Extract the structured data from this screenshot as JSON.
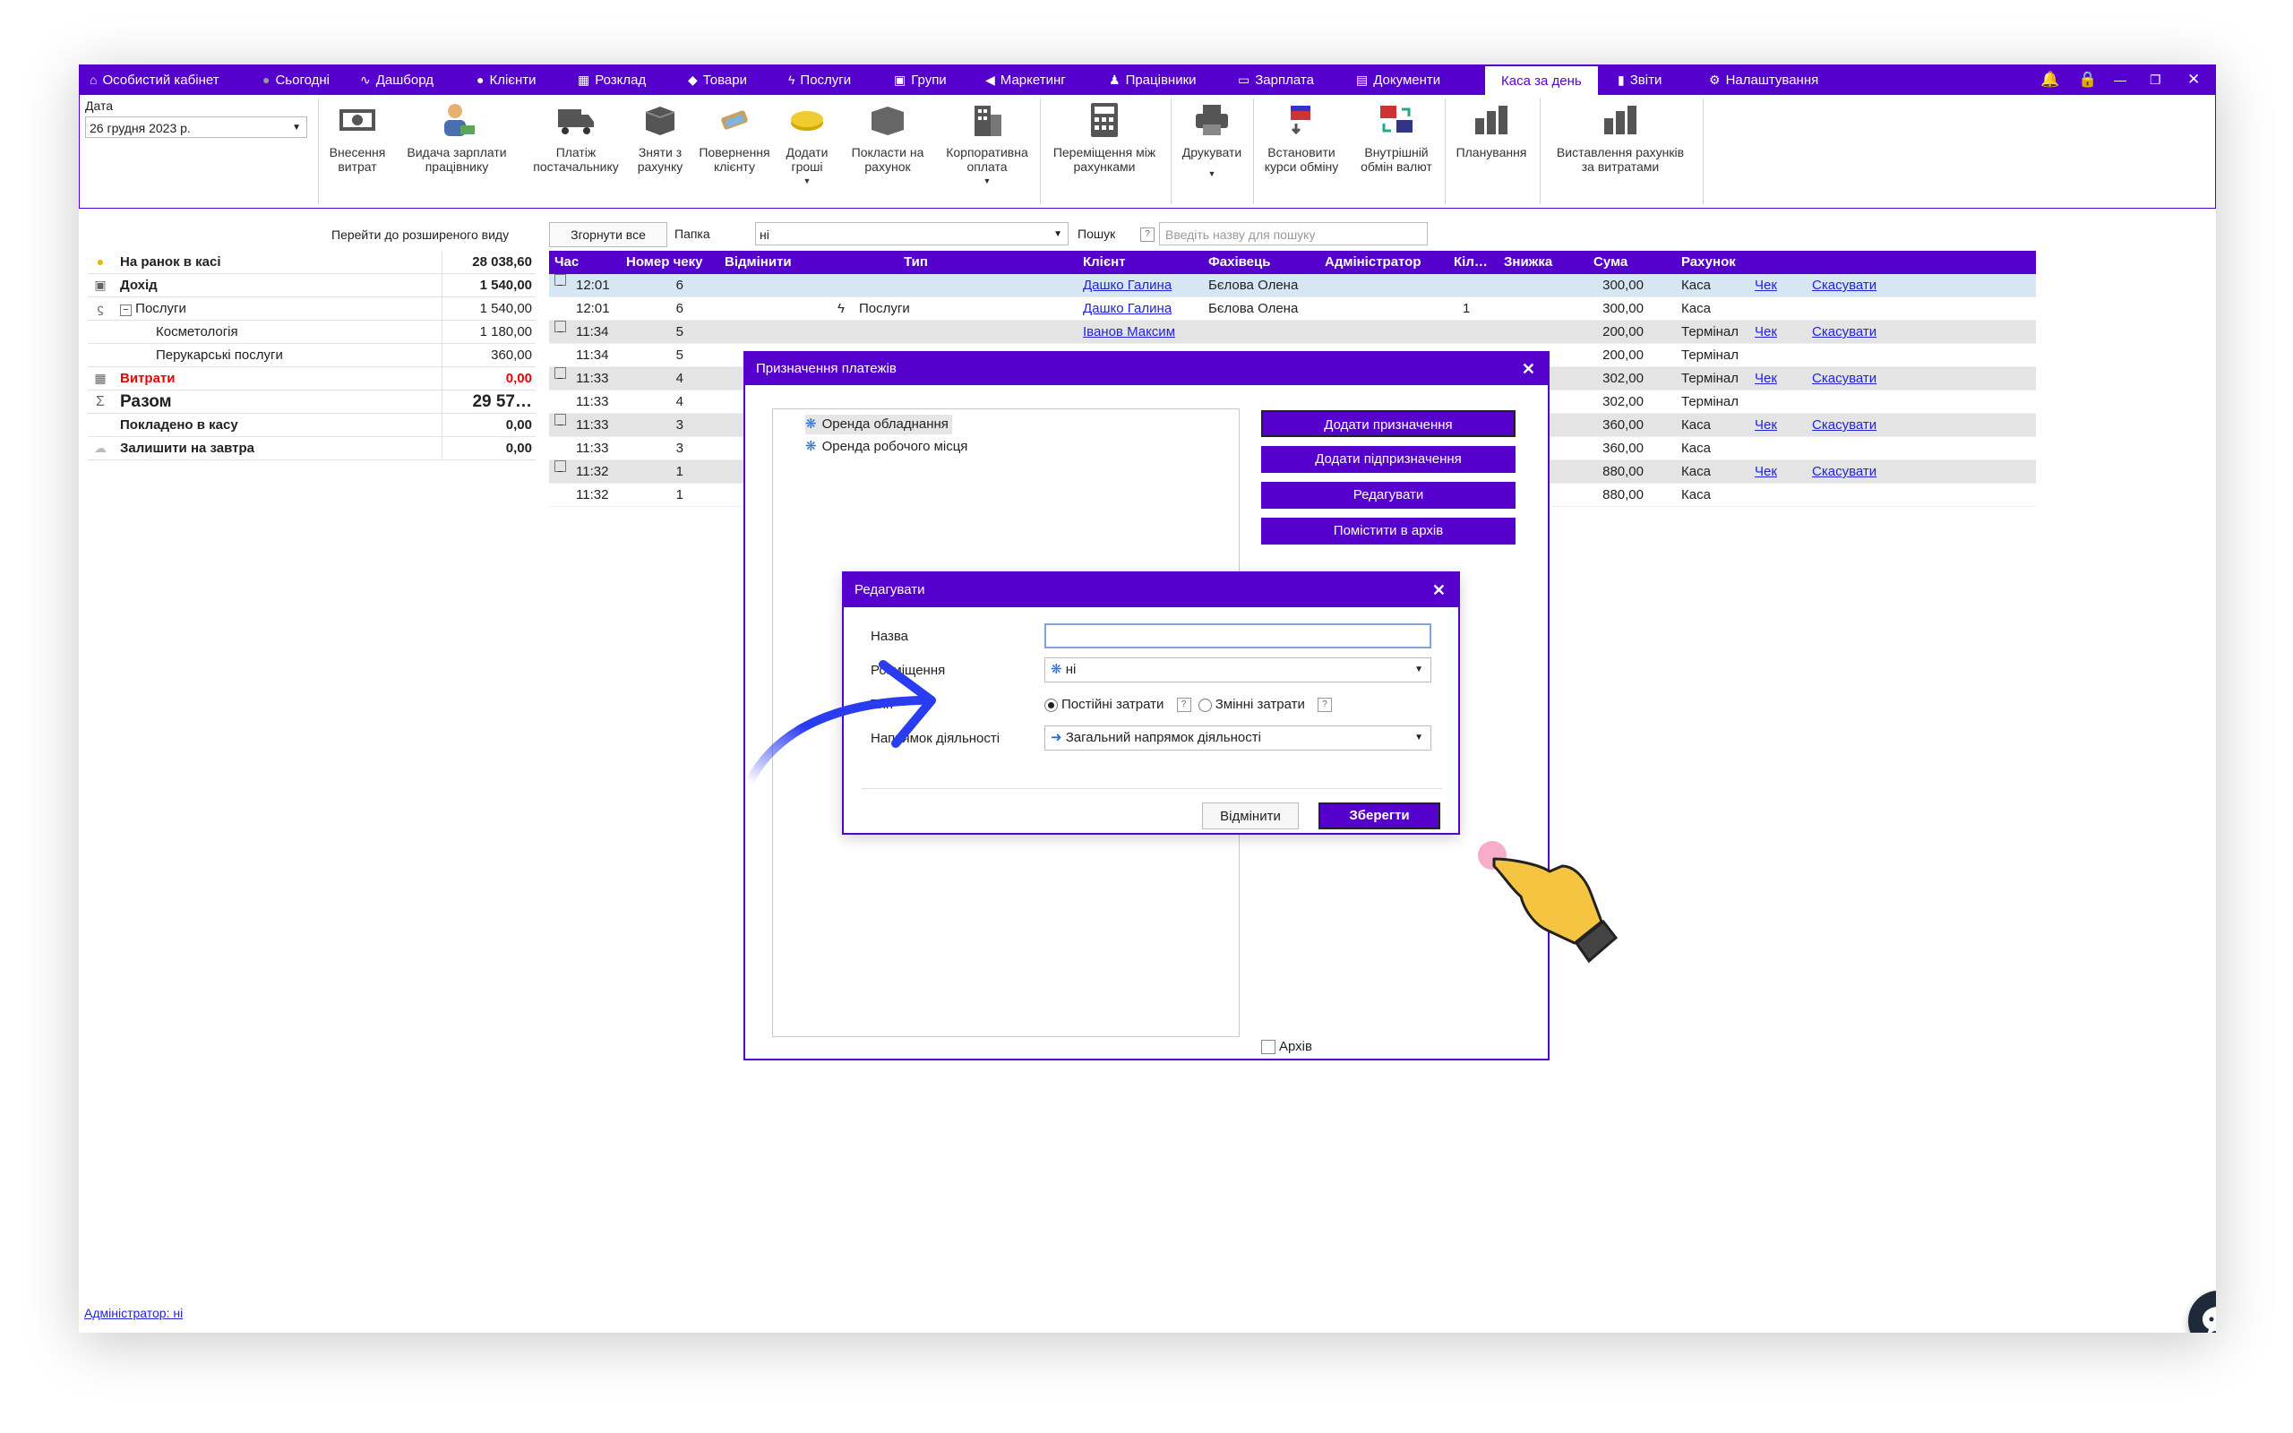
{
  "nav": {
    "items": [
      {
        "icon": "house-icon",
        "glyph": "⌂",
        "label": "Особистий кабінет"
      },
      {
        "icon": "clock-icon",
        "glyph": "●",
        "label": "Сьогодні"
      },
      {
        "icon": "pulse-icon",
        "glyph": "∿",
        "label": "Дашборд"
      },
      {
        "icon": "user-circle-icon",
        "glyph": "●",
        "label": "Клієнти"
      },
      {
        "icon": "calendar-icon",
        "glyph": "▦",
        "label": "Розклад"
      },
      {
        "icon": "box-icon",
        "glyph": "◆",
        "label": "Товари"
      },
      {
        "icon": "lightning-icon",
        "glyph": "ϟ",
        "label": "Послуги"
      },
      {
        "icon": "group-icon",
        "glyph": "▣",
        "label": "Групи"
      },
      {
        "icon": "megaphone-icon",
        "glyph": "◀",
        "label": "Маркетинг"
      },
      {
        "icon": "person-icon",
        "glyph": "♟",
        "label": "Працівники"
      },
      {
        "icon": "money-icon",
        "glyph": "▭",
        "label": "Зарплата"
      },
      {
        "icon": "document-icon",
        "glyph": "▤",
        "label": "Документи"
      },
      {
        "icon": "",
        "glyph": "",
        "label": "Каса за день"
      },
      {
        "icon": "bar-chart-icon",
        "glyph": "▮",
        "label": "Звіти"
      },
      {
        "icon": "gear-icon",
        "glyph": "⚙",
        "label": "Налаштування"
      }
    ]
  },
  "ribbon": {
    "date_label": "Дата",
    "date_value": "26 грудня  2023 р.",
    "buttons": [
      {
        "label": "Внесення\nвитрат",
        "glyph": "▣"
      },
      {
        "label": "Видача зарплати\nпрацівнику",
        "glyph": "♟"
      },
      {
        "label": "Платіж\nпостачальнику",
        "glyph": "▰"
      },
      {
        "label": "Зняти з\nрахунку",
        "glyph": "▩"
      },
      {
        "label": "Повернення\nклієнту",
        "glyph": "✎"
      },
      {
        "label": "Додати\nгроші",
        "glyph": "◉"
      },
      {
        "label": "Покласти на\nрахунок",
        "glyph": "▦"
      },
      {
        "label": "Корпоративна\nоплата",
        "glyph": "▥"
      },
      {
        "label": "Переміщення між\nрахунками",
        "glyph": "▦"
      },
      {
        "label": "Друкувати",
        "glyph": "▤"
      },
      {
        "label": "Встановити\nкурси обміну",
        "glyph": "⇅"
      },
      {
        "label": "Внутрішній\nобмін валют",
        "glyph": "⇄"
      },
      {
        "label": "Планування",
        "glyph": "▮"
      },
      {
        "label": "Виставлення рахунків\nза витратами",
        "glyph": "▮"
      }
    ]
  },
  "summary": {
    "ext_link": "Перейти до розширеного виду",
    "rows": [
      {
        "label": "На ранок в касі",
        "value": "28 038,60"
      },
      {
        "label": "Дохід",
        "value": "1 540,00"
      },
      {
        "label": "Послуги",
        "value": "1 540,00"
      },
      {
        "label": "Косметологія",
        "value": "1 180,00"
      },
      {
        "label": "Перукарські послуги",
        "value": "360,00"
      },
      {
        "label": "Витрати",
        "value": "0,00"
      },
      {
        "label": "Разом",
        "value": "29 57…"
      },
      {
        "label": "Покладено в касу",
        "value": "0,00"
      },
      {
        "label": "Залишити на завтра",
        "value": "0,00"
      }
    ]
  },
  "grid_toolbar": {
    "collapse_all": "Згорнути все",
    "folder_label": "Папка",
    "folder_value": "ні",
    "search_label": "Пошук",
    "search_placeholder": "Введіть назву для пошуку",
    "help": "?"
  },
  "grid": {
    "headers": [
      "Час",
      "Номер чеку",
      "Відмінити",
      "Тип",
      "Клієнт",
      "Фахівець",
      "Адміністратор",
      "Кіл…",
      "Знижка",
      "Сума",
      "Рахунок"
    ],
    "rows": [
      {
        "time": "12:01",
        "num": "6",
        "type": "",
        "client": "Дашко Галина",
        "master": "Бєлова Олена",
        "qty": "",
        "sum": "300,00",
        "account": "Каса",
        "check": "Чек",
        "cancel": "Скасувати"
      },
      {
        "time": "12:01",
        "num": "6",
        "type": "Послуги",
        "client": "Дашко Галина",
        "master": "Бєлова Олена",
        "qty": "1",
        "sum": "300,00",
        "account": "Каса",
        "check": "",
        "cancel": ""
      },
      {
        "time": "11:34",
        "num": "5",
        "type": "",
        "client": "Іванов Максим",
        "master": "",
        "qty": "",
        "sum": "200,00",
        "account": "Термінал",
        "check": "Чек",
        "cancel": "Скасувати"
      },
      {
        "time": "11:34",
        "num": "5",
        "type": "",
        "client": "",
        "master": "",
        "qty": "",
        "sum": "200,00",
        "account": "Термінал",
        "check": "",
        "cancel": ""
      },
      {
        "time": "11:33",
        "num": "4",
        "type": "",
        "client": "",
        "master": "",
        "qty": "",
        "sum": "302,00",
        "account": "Термінал",
        "check": "Чек",
        "cancel": "Скасувати"
      },
      {
        "time": "11:33",
        "num": "4",
        "type": "",
        "client": "",
        "master": "",
        "qty": "",
        "sum": "302,00",
        "account": "Термінал",
        "check": "",
        "cancel": ""
      },
      {
        "time": "11:33",
        "num": "3",
        "type": "",
        "client": "",
        "master": "",
        "qty": "",
        "sum": "360,00",
        "account": "Каса",
        "check": "Чек",
        "cancel": "Скасувати"
      },
      {
        "time": "11:33",
        "num": "3",
        "type": "",
        "client": "",
        "master": "",
        "qty": "",
        "sum": "360,00",
        "account": "Каса",
        "check": "",
        "cancel": ""
      },
      {
        "time": "11:32",
        "num": "1",
        "type": "",
        "client": "",
        "master": "",
        "qty": "",
        "sum": "880,00",
        "account": "Каса",
        "check": "Чек",
        "cancel": "Скасувати"
      },
      {
        "time": "11:32",
        "num": "1",
        "type": "",
        "client": "",
        "master": "",
        "qty": "",
        "sum": "880,00",
        "account": "Каса",
        "check": "",
        "cancel": ""
      }
    ]
  },
  "dialog_purpose": {
    "title": "Призначення платежів",
    "tree": [
      "Оренда обладнання",
      "Оренда робочого місця"
    ],
    "buttons": [
      "Додати призначення",
      "Додати підпризначення",
      "Редагувати",
      "Помістити в архів"
    ],
    "archive_label": "Архів"
  },
  "dialog_edit": {
    "title": "Редагувати",
    "name_label": "Назва",
    "name_value": "",
    "placement_label": "Розміщення",
    "placement_value": "ні",
    "type_label": "Тип",
    "type_fixed": "Постійні затрати",
    "type_variable": "Змінні затрати",
    "direction_label": "Напрямок діяльності",
    "direction_value": "Загальний напрямок діяльності",
    "cancel": "Відмінити",
    "save": "Зберегти",
    "help": "?"
  },
  "footer": {
    "admin": "Адміністратор: ні"
  },
  "colors": {
    "accent": "#5500cc",
    "link": "#2222dd",
    "danger": "#ee0000",
    "arrow": "#2a3cf0"
  }
}
